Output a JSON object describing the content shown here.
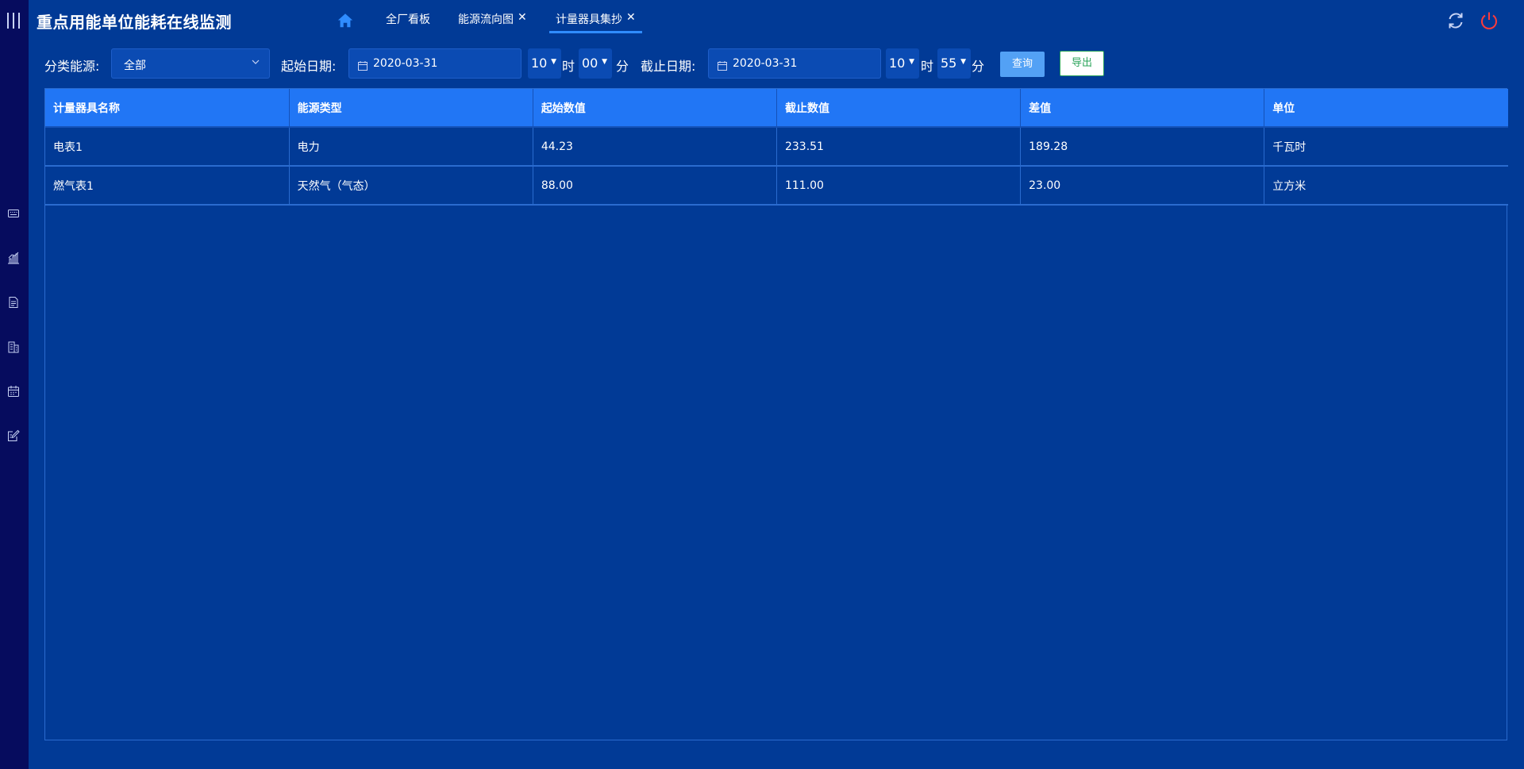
{
  "app": {
    "title": "重点用能单位能耗在线监测"
  },
  "sidebar": {
    "icons": [
      "keyboard-icon",
      "bar-chart-icon",
      "document-icon",
      "building-icon",
      "calendar-icon",
      "edit-icon"
    ]
  },
  "header": {
    "tabs": [
      {
        "label": "全厂看板",
        "closable": false,
        "active": false
      },
      {
        "label": "能源流向图",
        "closable": true,
        "active": false
      },
      {
        "label": "计量器具集抄",
        "closable": true,
        "active": true
      }
    ],
    "close_glyph": "✕"
  },
  "filters": {
    "category_label": "分类能源:",
    "category_value": "全部",
    "start_label": "起始日期:",
    "start_date": "2020-03-31",
    "start_hour": "10",
    "start_minute": "00",
    "end_label": "截止日期:",
    "end_date": "2020-03-31",
    "end_hour": "10",
    "end_minute": "55",
    "hour_unit": "时",
    "minute_unit": "分",
    "query_label": "查询",
    "export_label": "导出"
  },
  "table": {
    "columns": [
      "计量器具名称",
      "能源类型",
      "起始数值",
      "截止数值",
      "差值",
      "单位"
    ],
    "rows": [
      [
        "电表1",
        "电力",
        "44.23",
        "233.51",
        "189.28",
        "千瓦时"
      ],
      [
        "燃气表1",
        "天然气（气态）",
        "88.00",
        "111.00",
        "23.00",
        "立方米"
      ]
    ]
  },
  "colors": {
    "background": "#013a96",
    "sidebar": "#060c5e",
    "table_header": "#2176f5",
    "accent": "#2f8cff",
    "power": "#ff3b3b"
  }
}
